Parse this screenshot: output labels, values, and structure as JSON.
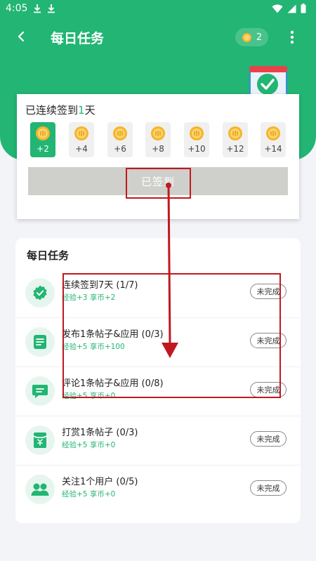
{
  "status_bar": {
    "time": "4:05"
  },
  "app_bar": {
    "title": "每日任务",
    "coin_count": "2"
  },
  "checkin": {
    "streak_prefix": "已连续签到",
    "streak_days": "1",
    "streak_suffix": "天",
    "days": [
      {
        "label": "+2",
        "checked": true
      },
      {
        "label": "+4",
        "checked": false
      },
      {
        "label": "+6",
        "checked": false
      },
      {
        "label": "+8",
        "checked": false
      },
      {
        "label": "+10",
        "checked": false
      },
      {
        "label": "+12",
        "checked": false
      },
      {
        "label": "+14",
        "checked": false
      }
    ],
    "button_label": "已签到"
  },
  "tasks": {
    "title": "每日任务",
    "items": [
      {
        "name": "连续签到7天 (1/7)",
        "reward": "经验+3 享币+2",
        "status": "未完成",
        "icon": "badge-check-icon"
      },
      {
        "name": "发布1条帖子&应用 (0/3)",
        "reward": "经验+5 享币+100",
        "status": "未完成",
        "icon": "post-icon"
      },
      {
        "name": "评论1条帖子&应用 (0/8)",
        "reward": "经验+5 享币+0",
        "status": "未完成",
        "icon": "comment-icon"
      },
      {
        "name": "打赏1条帖子 (0/3)",
        "reward": "经验+5 享币+0",
        "status": "未完成",
        "icon": "red-envelope-icon"
      },
      {
        "name": "关注1个用户 (0/5)",
        "reward": "经验+5 享币+0",
        "status": "未完成",
        "icon": "users-icon"
      }
    ]
  },
  "colors": {
    "primary": "#22b573",
    "annotation": "#c0181f"
  }
}
